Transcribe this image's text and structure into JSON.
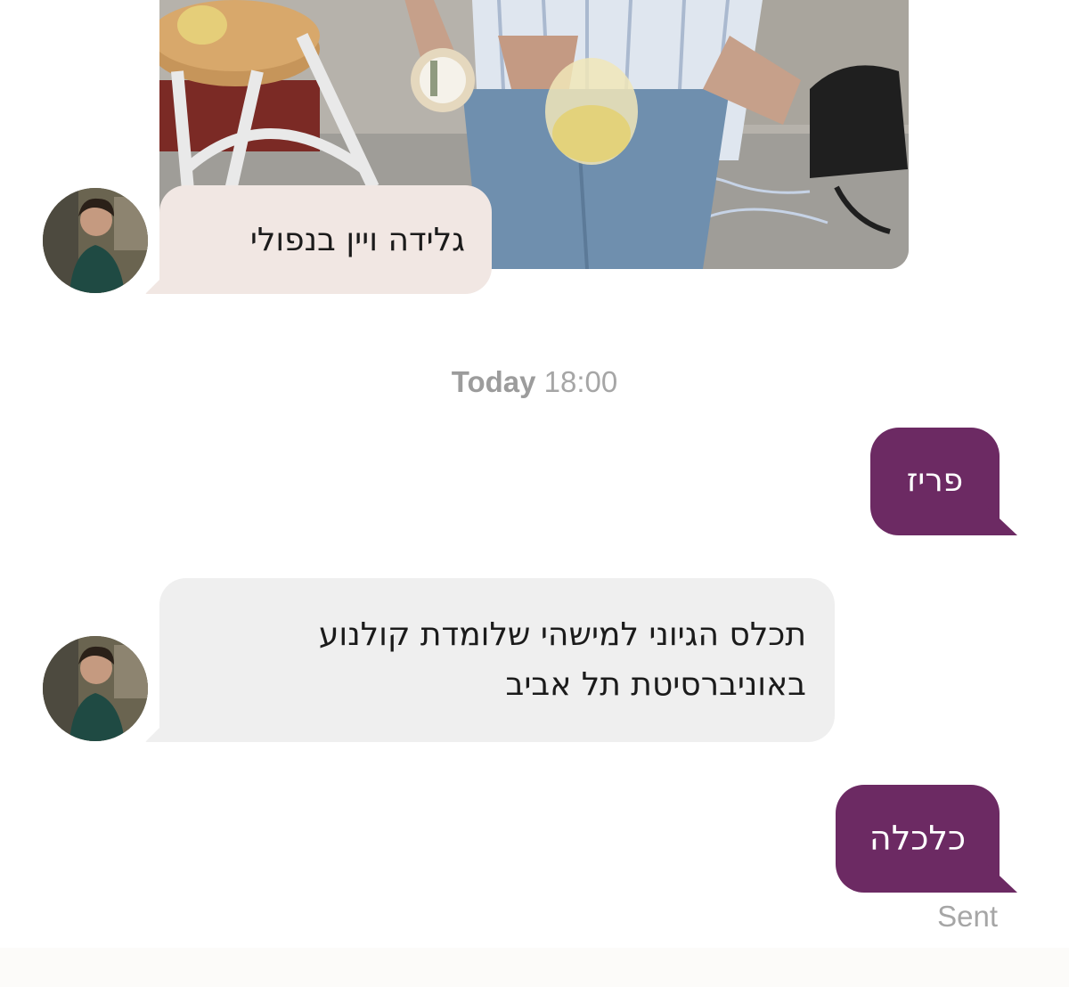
{
  "conversation": {
    "messages": [
      {
        "direction": "in",
        "text": "גלידה ויין בנפולי",
        "has_photo": true
      },
      {
        "direction": "out",
        "text": "פריז"
      },
      {
        "direction": "in",
        "text": "תכלס הגיוני למישהי שלומדת קולנוע באוניברסיטת תל אביב"
      },
      {
        "direction": "out",
        "text": "כלכלה"
      }
    ],
    "separator": {
      "day": "Today",
      "time": "18:00"
    },
    "status": "Sent"
  },
  "colors": {
    "outgoing_bubble": "#6c2a63",
    "incoming_bubble_pink": "#f1e7e3",
    "incoming_bubble_gray": "#efefef",
    "meta_text": "#a6a6a6"
  }
}
